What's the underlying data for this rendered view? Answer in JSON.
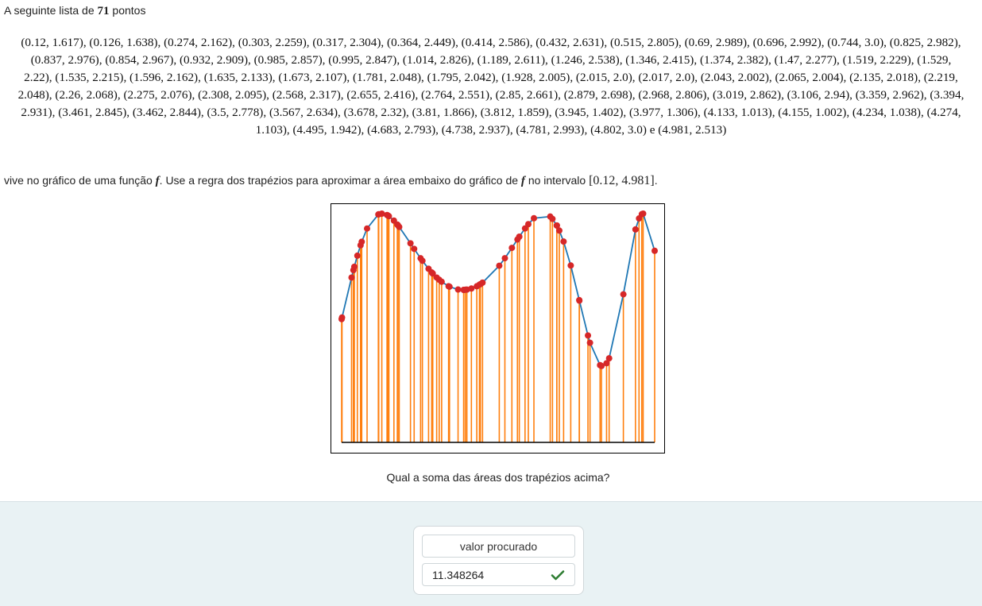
{
  "intro": {
    "prefix": "A seguinte lista de",
    "count": "71",
    "suffix": "pontos"
  },
  "points_text": "(0.12, 1.617), (0.126, 1.638), (0.274, 2.162), (0.303, 2.259), (0.317, 2.304), (0.364, 2.449), (0.414, 2.586), (0.432, 2.631), (0.515, 2.805), (0.69, 2.989), (0.696, 2.992), (0.744, 3.0), (0.825, 2.982), (0.837, 2.976), (0.854, 2.967), (0.932, 2.909), (0.985, 2.857), (0.995, 2.847), (1.014, 2.826), (1.189, 2.611), (1.246, 2.538), (1.346, 2.415), (1.374, 2.382), (1.47, 2.277), (1.519, 2.229), (1.529, 2.22), (1.535, 2.215), (1.596, 2.162), (1.635, 2.133), (1.673, 2.107), (1.781, 2.048), (1.795, 2.042), (1.928, 2.005), (2.015, 2.0), (2.017, 2.0), (2.043, 2.002), (2.065, 2.004), (2.135, 2.018), (2.219, 2.048), (2.26, 2.068), (2.275, 2.076), (2.308, 2.095), (2.568, 2.317), (2.655, 2.416), (2.764, 2.551), (2.85, 2.661), (2.879, 2.698), (2.968, 2.806), (3.019, 2.862), (3.106, 2.94), (3.359, 2.962), (3.394, 2.931), (3.461, 2.845), (3.462, 2.844), (3.5, 2.778), (3.567, 2.634), (3.678, 2.32), (3.81, 1.866), (3.812, 1.859), (3.945, 1.402), (3.977, 1.306), (4.133, 1.013), (4.155, 1.002), (4.234, 1.038), (4.274, 1.103), (4.495, 1.942), (4.683, 2.793), (4.738, 2.937), (4.781, 2.993), (4.802, 3.0) e (4.981, 2.513)",
  "description": {
    "part1": "vive no gráfico de uma função",
    "fname": "f",
    "part2": ". Use a regra dos trapézios para aproximar a área embaixo do gráfico de",
    "part3": "no intervalo",
    "interval": "[0.12, 4.981]",
    "end": "."
  },
  "question": "Qual a soma das áreas dos trapézios acima?",
  "answer": {
    "label": "valor procurado",
    "value": "11.348264",
    "status_icon": "check-icon",
    "status_color": "#2e7d32"
  },
  "colors": {
    "curve": "#1f77b4",
    "bars": "#ff7f0e",
    "points": "#d62728"
  },
  "chart_data": {
    "type": "line",
    "x": [
      0.12,
      0.126,
      0.274,
      0.303,
      0.317,
      0.364,
      0.414,
      0.432,
      0.515,
      0.69,
      0.696,
      0.744,
      0.825,
      0.837,
      0.854,
      0.932,
      0.985,
      0.995,
      1.014,
      1.189,
      1.246,
      1.346,
      1.374,
      1.47,
      1.519,
      1.529,
      1.535,
      1.596,
      1.635,
      1.673,
      1.781,
      1.795,
      1.928,
      2.015,
      2.017,
      2.043,
      2.065,
      2.135,
      2.219,
      2.26,
      2.275,
      2.308,
      2.568,
      2.655,
      2.764,
      2.85,
      2.879,
      2.968,
      3.019,
      3.106,
      3.359,
      3.394,
      3.461,
      3.462,
      3.5,
      3.567,
      3.678,
      3.81,
      3.812,
      3.945,
      3.977,
      4.133,
      4.155,
      4.234,
      4.274,
      4.495,
      4.683,
      4.738,
      4.781,
      4.802,
      4.981
    ],
    "y": [
      1.617,
      1.638,
      2.162,
      2.259,
      2.304,
      2.449,
      2.586,
      2.631,
      2.805,
      2.989,
      2.992,
      3.0,
      2.982,
      2.976,
      2.967,
      2.909,
      2.857,
      2.847,
      2.826,
      2.611,
      2.538,
      2.415,
      2.382,
      2.277,
      2.229,
      2.22,
      2.215,
      2.162,
      2.133,
      2.107,
      2.048,
      2.042,
      2.005,
      2.0,
      2.0,
      2.002,
      2.004,
      2.018,
      2.048,
      2.068,
      2.076,
      2.095,
      2.317,
      2.416,
      2.551,
      2.661,
      2.698,
      2.806,
      2.862,
      2.94,
      2.962,
      2.931,
      2.845,
      2.844,
      2.778,
      2.634,
      2.32,
      1.866,
      1.859,
      1.402,
      1.306,
      1.013,
      1.002,
      1.038,
      1.103,
      1.942,
      2.793,
      2.937,
      2.993,
      3.0,
      2.513
    ],
    "title": "",
    "xlabel": "",
    "ylabel": "",
    "grid": false,
    "axes_visible": false,
    "baseline": 0
  }
}
